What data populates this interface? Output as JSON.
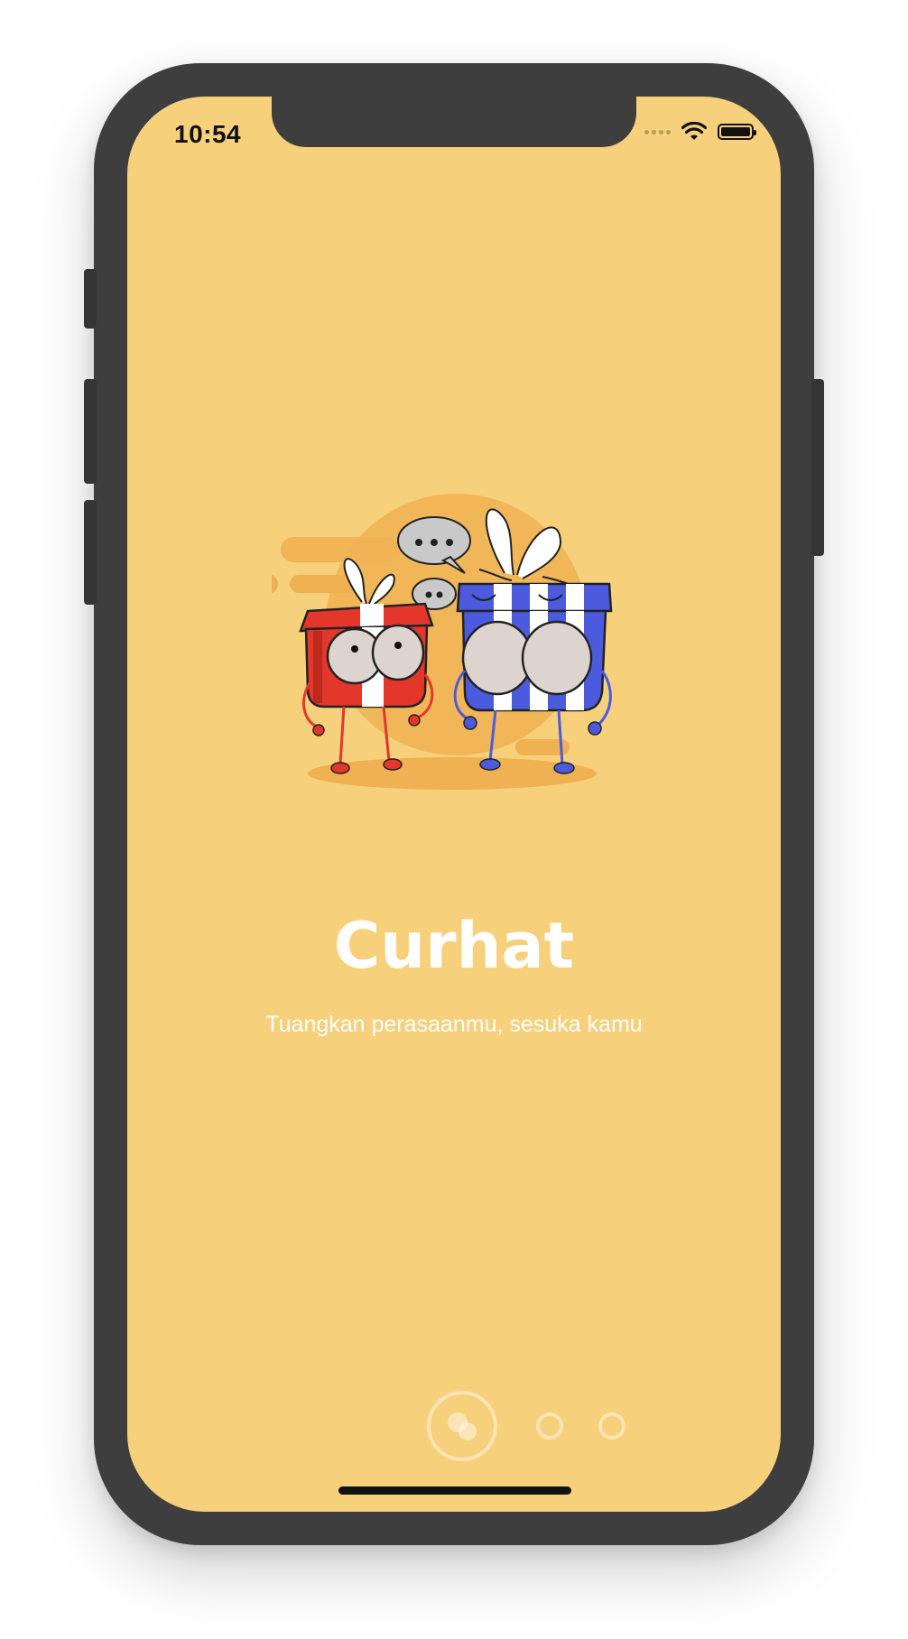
{
  "status_bar": {
    "time": "10:54"
  },
  "onboarding": {
    "title": "Curhat",
    "subtitle": "Tuangkan perasaanmu, sesuka kamu"
  },
  "pager": {
    "total_pages": 3,
    "current_page": 1
  },
  "colors": {
    "background": "#f7d07c",
    "accent": "#f0b152",
    "text": "#ffffff",
    "device_frame": "#3e3e3e"
  },
  "icons": {
    "wifi": "wifi-icon",
    "battery": "battery-icon",
    "signal": "signal-dots-icon",
    "chat": "chat-bubbles-icon"
  }
}
